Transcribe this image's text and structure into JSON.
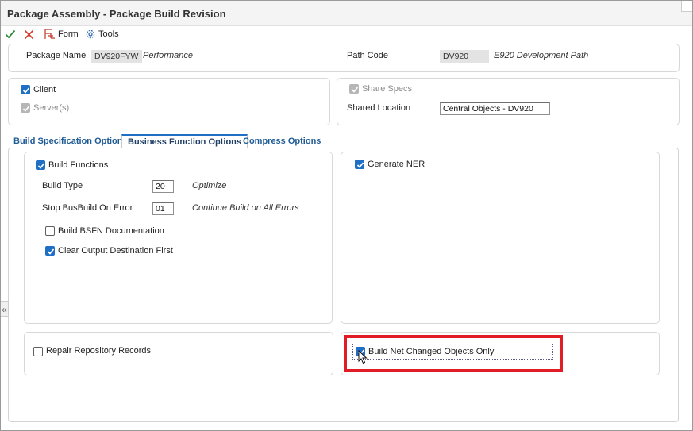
{
  "window": {
    "title": "Package Assembly - Package Build Revision"
  },
  "toolbar": {
    "ok_icon": "checkmark-icon",
    "cancel_icon": "x-icon",
    "form_label": "Form",
    "tools_label": "Tools",
    "colors": {
      "ok": "#2e8b3a",
      "cancel": "#d23a2a",
      "form": "#c0392b",
      "tools": "#1f5fa8"
    }
  },
  "header": {
    "package_name_label": "Package Name",
    "package_name_value": "DV920FYW",
    "package_description": "Performance",
    "path_code_label": "Path Code",
    "path_code_value": "DV920",
    "path_code_description": "E920 Development Path"
  },
  "targets": {
    "client_label": "Client",
    "client_checked": true,
    "servers_label": "Server(s)",
    "servers_checked": true
  },
  "shared": {
    "share_specs_label": "Share Specs",
    "share_specs_checked": true,
    "shared_location_label": "Shared Location",
    "shared_location_value": "Central Objects - DV920"
  },
  "tabs": [
    {
      "label": "Build Specification Options",
      "active": false
    },
    {
      "label": "Business Function Options",
      "active": true
    },
    {
      "label": "Compress Options",
      "active": false
    }
  ],
  "bsfn_options": {
    "build_functions_label": "Build Functions",
    "build_functions_checked": true,
    "build_type_label": "Build Type",
    "build_type_value": "20",
    "build_type_description": "Optimize",
    "stop_on_error_label": "Stop BusBuild On Error",
    "stop_on_error_value": "01",
    "stop_on_error_description": "Continue Build on All Errors",
    "build_bsfn_doc_label": "Build BSFN Documentation",
    "build_bsfn_doc_checked": false,
    "clear_output_label": "Clear Output Destination First",
    "clear_output_checked": true
  },
  "ner": {
    "generate_ner_label": "Generate NER",
    "generate_ner_checked": true
  },
  "repair": {
    "repair_label": "Repair Repository Records",
    "repair_checked": false
  },
  "net_change": {
    "label": "Build Net Changed Objects Only",
    "checked": true
  },
  "sidebar": {
    "collapse_glyph": "«"
  },
  "accent": {
    "highlight": "#e11c24",
    "checkbox": "#1f6fc5"
  }
}
